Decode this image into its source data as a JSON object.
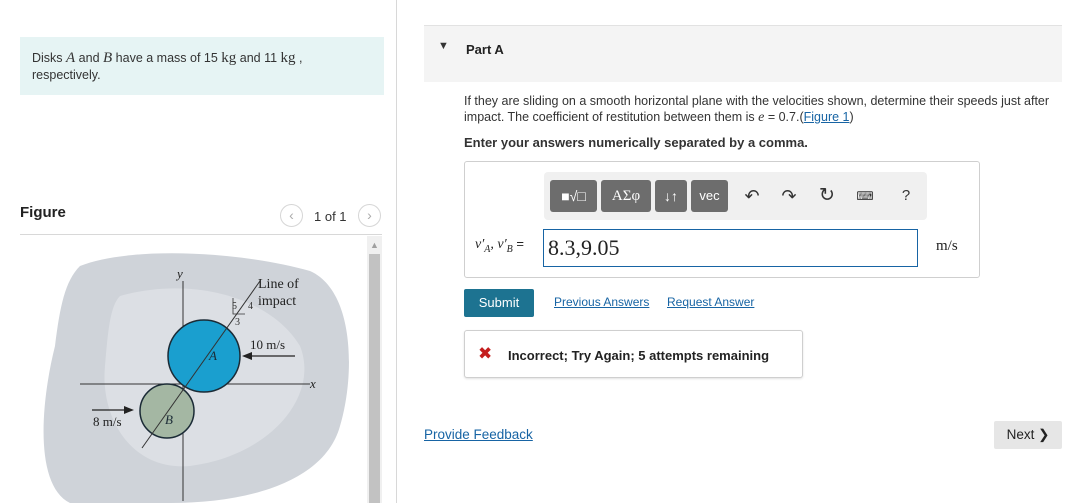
{
  "problem": {
    "t1": "Disks ",
    "disk_a": "A",
    "t2": " and ",
    "disk_b": "B",
    "t3": " have a mass of 15 ",
    "unit1": "kg",
    "t4": " and 11 ",
    "unit2": "kg",
    "t5": " ,",
    "t6": "respectively."
  },
  "figure": {
    "title": "Figure",
    "pager": "1 of 1",
    "prev_icon": "chevron-left-icon",
    "next_icon": "chevron-right-icon",
    "labels": {
      "y_axis": "y",
      "x_axis": "x",
      "line_of_impact_1": "Line of",
      "line_of_impact_2": "impact",
      "slope_5": "5",
      "slope_4": "4",
      "slope_3": "3",
      "velocity_a": "10 m/s",
      "velocity_b": "8 m/s",
      "disk_a": "A",
      "disk_b": "B"
    },
    "colors": {
      "disk_a": "#1a9fcf",
      "disk_b": "#a4b7a3",
      "background_blob": "#cfd3d9"
    }
  },
  "part": {
    "title": "Part A",
    "question_prefix": "If they are sliding on a smooth horizontal plane with the velocities shown, determine their speeds just after impact. The coefficient of restitution between them is ",
    "question_e": "e",
    "question_mid": " = 0.7.",
    "figure_link": "Figure 1",
    "instruction": "Enter your answers numerically separated by a comma."
  },
  "toolbar": {
    "templates_label": "■√□",
    "greek_label": "ΑΣφ",
    "arrows_label": "↓↑",
    "vec_label": "vec",
    "undo_icon": "↶",
    "redo_icon": "↷",
    "reset_icon": "↻",
    "keyboard_icon": "⌨",
    "help_label": "?"
  },
  "answer": {
    "label_va": "v′",
    "label_va_sub": "A",
    "label_sep": ", ",
    "label_vb": "v′",
    "label_vb_sub": "B",
    "label_eq": " =",
    "value": "8.3,9.05",
    "unit": "m/s"
  },
  "actions": {
    "submit": "Submit",
    "previous_answers": "Previous Answers",
    "request_answer": "Request Answer"
  },
  "feedback": {
    "icon": "✖",
    "text": "Incorrect; Try Again; 5 attempts remaining"
  },
  "footer": {
    "provide_feedback": "Provide Feedback",
    "next": "Next ❯"
  },
  "colors": {
    "accent_link": "#1764a4",
    "submit_bg": "#1d7391",
    "error": "#c41e1e",
    "problem_bg": "#e6f4f4"
  }
}
